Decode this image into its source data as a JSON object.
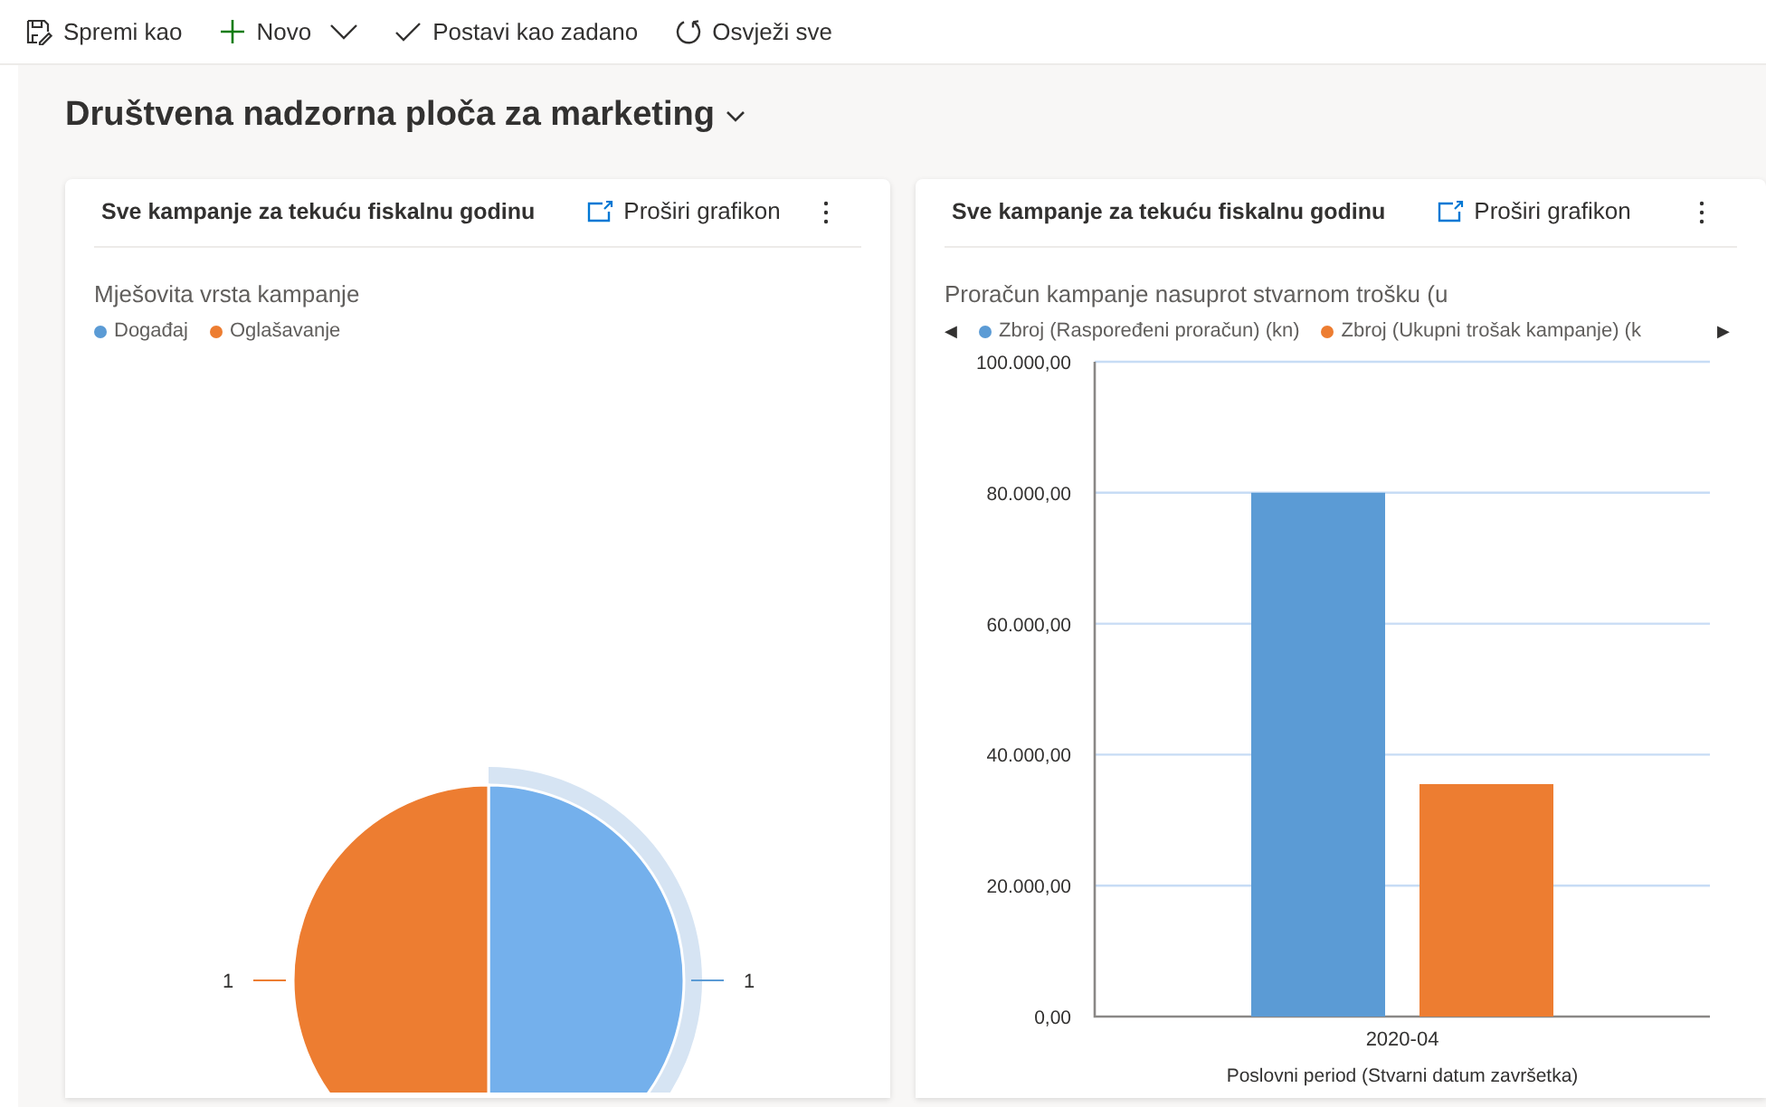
{
  "toolbar": [
    {
      "kind": "save",
      "label": "Spremi kao"
    },
    {
      "kind": "new",
      "label": "Novo",
      "dropdown": true
    },
    {
      "kind": "check",
      "label": "Postavi kao zadano"
    },
    {
      "kind": "refresh",
      "label": "Osvježi sve"
    }
  ],
  "dashboard": {
    "title": "Društvena nadzorna ploča za marketing"
  },
  "cards": [
    {
      "title": "Sve kampanje za tekuću fiskalnu godinu",
      "expand_label": "Proširi grafikon",
      "slices": [
        {
          "color": "#5b9bd5"
        },
        {
          "color": "#ed7d31"
        }
      ],
      "chart_data": {
        "type": "pie",
        "title": "Mješovita vrsta kampanje",
        "categories": [
          "Događaj",
          "Oglašavanje"
        ],
        "values": [
          1,
          1
        ],
        "data_labels": true
      }
    },
    {
      "title": "Sve kampanje za tekuću fiskalnu godinu",
      "expand_label": "Proširi grafikon",
      "legend_nav": {
        "prev": "◀",
        "next": "▶"
      },
      "chart_data": {
        "type": "bar",
        "title": "Proračun kampanje nasuprot stvarnom trošku (u",
        "grid": true,
        "categories": [
          "2020-04"
        ],
        "xlabel": "Poslovni period (Stvarni datum završetka)",
        "series": [
          {
            "name": "Zbroj (Raspoređeni proračun) (kn)",
            "color": "#5b9bd5",
            "values": [
              80000
            ]
          },
          {
            "name": "Zbroj (Ukupni trošak kampanje) (k",
            "color": "#ed7d31",
            "values": [
              35500
            ]
          }
        ],
        "ylim": [
          0,
          100000
        ],
        "yticks": [
          {
            "value": 0,
            "label": "0,00"
          },
          {
            "value": 20000,
            "label": "20.000,00"
          },
          {
            "value": 40000,
            "label": "40.000,00"
          },
          {
            "value": 60000,
            "label": "60.000,00"
          },
          {
            "value": 80000,
            "label": "80.000,00"
          },
          {
            "value": 100000,
            "label": "100.000,00"
          }
        ]
      }
    }
  ]
}
